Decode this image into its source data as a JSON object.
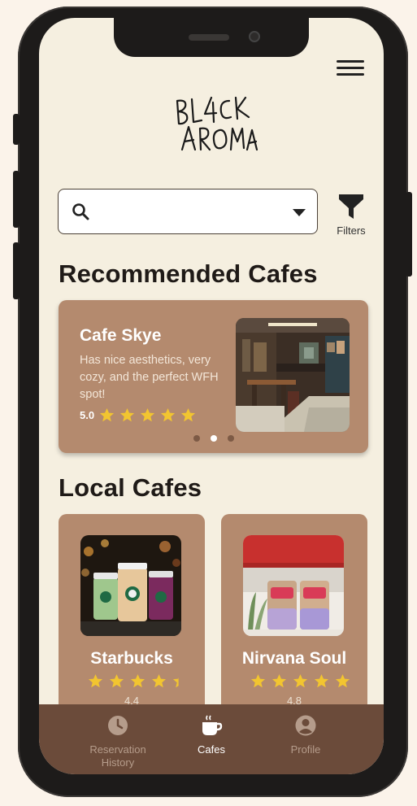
{
  "app": {
    "brand_logo_text": "BLACK AROMA"
  },
  "search": {
    "placeholder": "",
    "filters_label": "Filters"
  },
  "recommended": {
    "title": "Recommended Cafes",
    "card": {
      "name": "Cafe Skye",
      "description": "Has nice aesthetics, very cozy, and the perfect WFH spot!",
      "rating": "5.0",
      "stars": 5
    },
    "carousel_active_index": 1,
    "carousel_count": 3
  },
  "local": {
    "title": "Local Cafes",
    "cafes": [
      {
        "name": "Starbucks",
        "rating": "4.4",
        "stars": 4.4
      },
      {
        "name": "Nirvana Soul",
        "rating": "4.8",
        "stars": 5
      }
    ]
  },
  "bottom_nav": [
    {
      "label": "Reservation History",
      "icon": "clock-icon",
      "active": false
    },
    {
      "label": "Cafes",
      "icon": "coffee-cup-icon",
      "active": true
    },
    {
      "label": "Profile",
      "icon": "user-icon",
      "active": false
    }
  ],
  "colors": {
    "background": "#f5efe0",
    "card": "#b48a6e",
    "nav": "#6b4b3a",
    "star": "#f2c530",
    "text_dark": "#1f1a17"
  }
}
